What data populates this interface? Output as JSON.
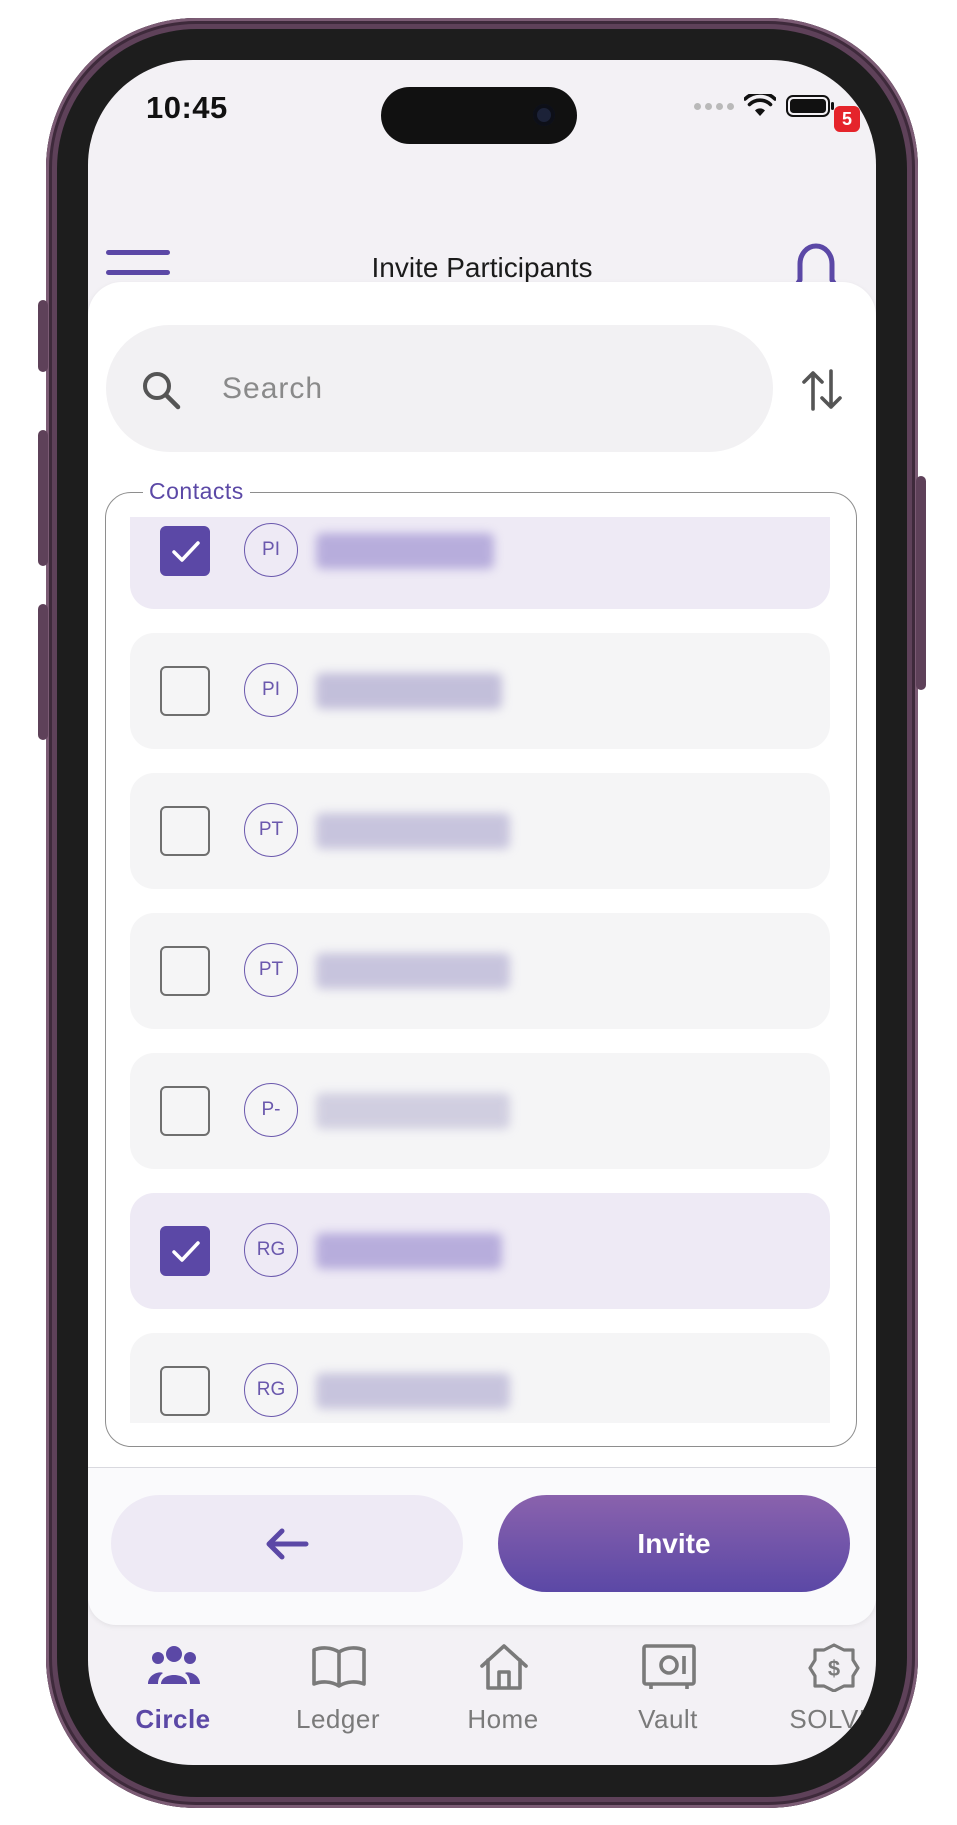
{
  "status_bar": {
    "time": "10:45"
  },
  "header": {
    "title": "Invite Participants",
    "notification_count": "5"
  },
  "search": {
    "placeholder": "Search"
  },
  "contacts": {
    "legend": "Contacts",
    "items": [
      {
        "initials": "PI",
        "selected": true
      },
      {
        "initials": "PI",
        "selected": false
      },
      {
        "initials": "PT",
        "selected": false
      },
      {
        "initials": "PT",
        "selected": false
      },
      {
        "initials": "P-",
        "selected": false
      },
      {
        "initials": "RG",
        "selected": true
      },
      {
        "initials": "RG",
        "selected": false
      }
    ]
  },
  "footer": {
    "invite_label": "Invite"
  },
  "nav": {
    "items": [
      {
        "label": "Circle",
        "icon": "people-icon",
        "active": true
      },
      {
        "label": "Ledger",
        "icon": "book-icon",
        "active": false
      },
      {
        "label": "Home",
        "icon": "home-icon",
        "active": false
      },
      {
        "label": "Vault",
        "icon": "safe-icon",
        "active": false
      },
      {
        "label": "SOLVE",
        "icon": "solve-icon",
        "active": false
      }
    ]
  },
  "colors": {
    "accent": "#5b48a6",
    "selected_row": "#eeeaf5",
    "row": "#f5f5f6",
    "badge": "#e5242b"
  }
}
